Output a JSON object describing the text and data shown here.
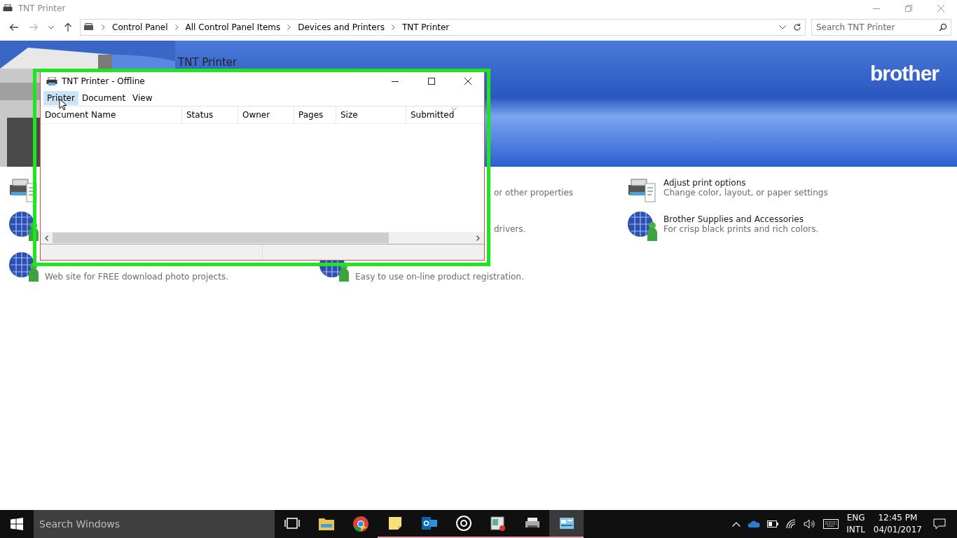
{
  "window": {
    "title": "TNT Printer"
  },
  "address_bar": {
    "breadcrumbs": [
      "Control Panel",
      "All Control Panel Items",
      "Devices and Printers",
      "TNT Printer"
    ]
  },
  "search": {
    "placeholder": "Search TNT Printer"
  },
  "banner": {
    "title": "TNT Printer",
    "brand": "brother"
  },
  "tasks": [
    {
      "kind": "printer"
    },
    {
      "kind": "hidden",
      "description": "or other properties"
    },
    {
      "kind": "printer",
      "title": "Adjust print options",
      "description": "Change color, layout, or paper settings"
    },
    {
      "kind": "globe"
    },
    {
      "kind": "hidden",
      "description": "drivers."
    },
    {
      "kind": "globe",
      "title": "Brother Supplies and Accessories",
      "description": "For crisp black prints and rich colors."
    },
    {
      "kind": "globe",
      "description": "Web site for FREE download photo projects."
    },
    {
      "kind": "globe",
      "description": "Easy to use on-line product registration."
    }
  ],
  "queue_window": {
    "title": "TNT Printer - Offline",
    "menu": [
      {
        "label": "Printer",
        "selected": true
      },
      {
        "label": "Document",
        "selected": false
      },
      {
        "label": "View",
        "selected": false
      }
    ],
    "columns": [
      "Document Name",
      "Status",
      "Owner",
      "Pages",
      "Size",
      "Submitted"
    ]
  },
  "taskbar": {
    "search_placeholder": "Search Windows",
    "apps": [
      {
        "kind": "taskview",
        "running": false,
        "selected": false
      },
      {
        "kind": "folder",
        "running": false,
        "selected": false
      },
      {
        "kind": "chrome",
        "running": false,
        "selected": false
      },
      {
        "kind": "notes",
        "running": true,
        "selected": false
      },
      {
        "kind": "outlook",
        "running": true,
        "selected": false
      },
      {
        "kind": "groove",
        "running": true,
        "selected": false
      },
      {
        "kind": "window",
        "running": true,
        "selected": false
      },
      {
        "kind": "printer",
        "running": true,
        "selected": false
      },
      {
        "kind": "panel",
        "running": true,
        "selected": true
      }
    ],
    "language": [
      "ENG",
      "INTL"
    ],
    "time": "12:45 PM",
    "date": "04/01/2017"
  }
}
